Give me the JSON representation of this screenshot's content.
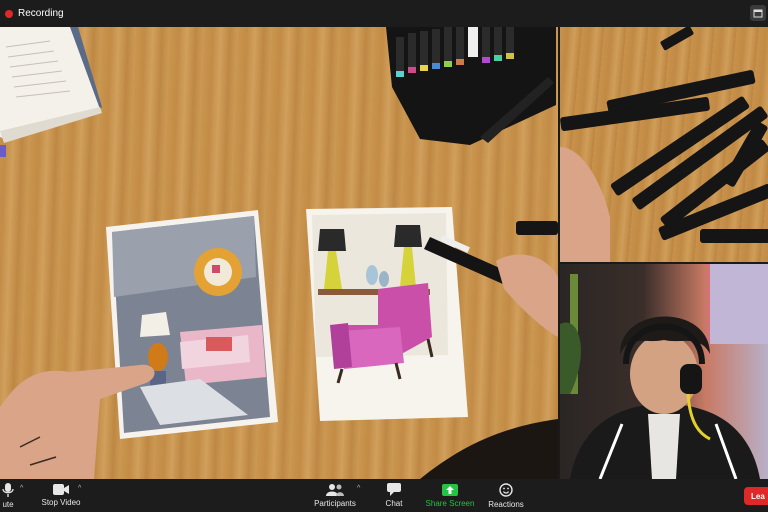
{
  "topbar": {
    "recording_label": "Recording"
  },
  "toolbar": {
    "mute_label": "ute",
    "stop_video_label": "Stop Video",
    "participants_label": "Participants",
    "chat_label": "Chat",
    "share_screen_label": "Share Screen",
    "reactions_label": "Reactions",
    "leave_label": "Lea"
  },
  "colors": {
    "recording": "#e02828",
    "share_screen": "#25c244",
    "leave": "#e02828"
  },
  "icons": [
    "calendar-icon",
    "microphone-icon",
    "video-camera-icon",
    "participants-icon",
    "chat-icon",
    "share-screen-icon",
    "reactions-icon",
    "caret-up-icon"
  ]
}
